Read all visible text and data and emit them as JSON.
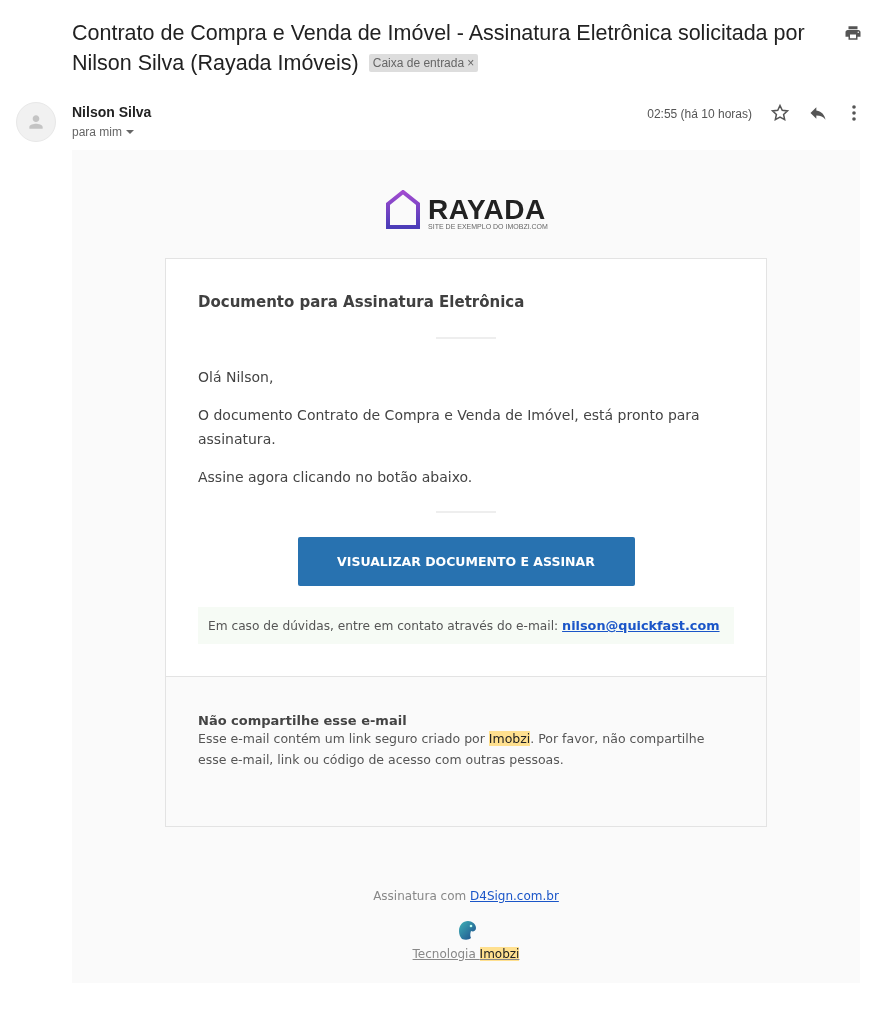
{
  "subject": {
    "title": "Contrato de Compra e Venda de Imóvel - Assinatura Eletrônica solicitada por Nilson Silva (Rayada Imóveis)",
    "label": "Caixa de entrada",
    "label_remove": "×"
  },
  "message": {
    "sender": "Nilson Silva",
    "recipient": "para mim",
    "time": "02:55 (há 10 horas)",
    "starred": false
  },
  "email": {
    "logo": {
      "name": "RAYADA",
      "tagline": "SITE DE EXEMPLO DO IMOBZI.COM"
    },
    "heading": "Documento para Assinatura Eletrônica",
    "greeting": "Olá Nilson,",
    "paragraphs": [
      "O documento Contrato de Compra e Venda de Imóvel, está pronto para assinatura.",
      "Assine agora clicando no botão abaixo."
    ],
    "button": "VISUALIZAR DOCUMENTO E ASSINAR",
    "contact": {
      "text": "Em caso de dúvidas, entre em contato através do e-mail:",
      "link": "nilson@quickfast.com"
    },
    "notice": {
      "title": "Não compartilhe esse e-mail",
      "parts": [
        {
          "text": "Esse e-mail contém um link seguro criado por ",
          "highlighted": false
        },
        {
          "text": "Imobzi",
          "highlighted": true
        },
        {
          "text": ". Por favor, não compartilhe esse e-mail, link ou código de acesso com outras pessoas.",
          "highlighted": false
        }
      ]
    },
    "footer": {
      "signature_text": "Assinatura com",
      "signature_link": "D4Sign.com.br",
      "tech_parts": [
        {
          "text": "Tecnologia ",
          "highlighted": false
        },
        {
          "text": "Imobzi",
          "highlighted": true
        }
      ]
    }
  }
}
